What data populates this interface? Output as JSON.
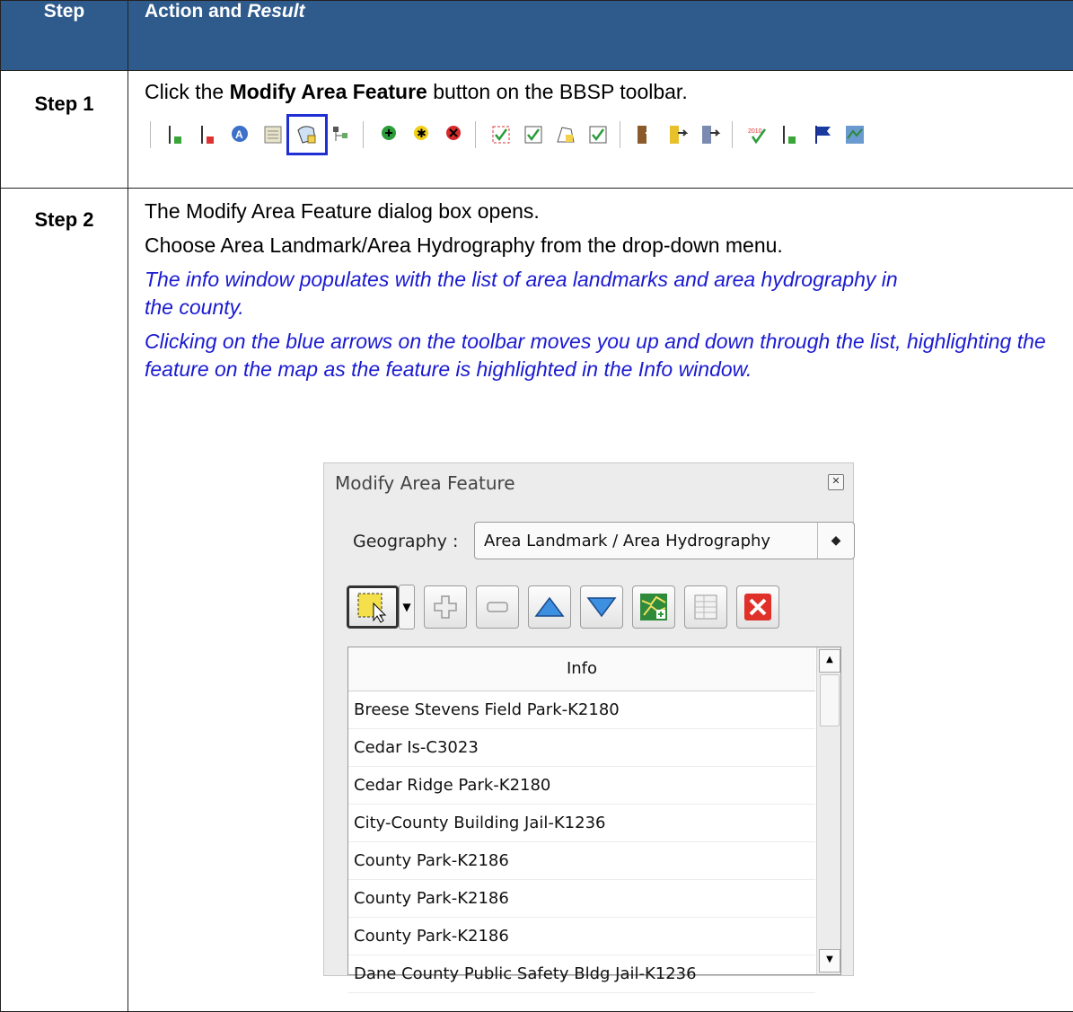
{
  "header": {
    "col1": "Step",
    "col2_prefix": "Action and ",
    "col2_italic": "Result"
  },
  "step1": {
    "label": "Step 1",
    "pre": "Click the ",
    "bold": "Modify Area Feature",
    "post": " button on the BBSP toolbar.",
    "toolbar_icons": [
      "add-line-icon",
      "delete-line-icon",
      "label-icon",
      "edit-table-icon",
      "modify-area-feature-icon",
      "tree-icon",
      "add-point-icon",
      "move-point-icon",
      "delete-point-icon",
      "check-1-icon",
      "check-2-icon",
      "check-3-icon",
      "check-4-icon",
      "export-1-icon",
      "export-2-icon",
      "export-3-icon",
      "census-2010-icon",
      "add-line-2-icon",
      "flag-icon",
      "map-icon"
    ]
  },
  "step2": {
    "label": "Step 2",
    "line1": "The Modify Area Feature dialog box opens.",
    "line2": "Choose Area Landmark/Area Hydrography from the drop-down menu.",
    "result1": "The info window populates with the list of area landmarks and area hydrography in the county.",
    "result2": "Clicking on the blue arrows on the toolbar moves you up and down through the list, highlighting the feature on the map as the feature is highlighted in the Info window."
  },
  "dialog": {
    "title": "Modify Area Feature",
    "geography_label": "Geography :",
    "geography_value": "Area Landmark / Area Hydrography",
    "list_header": "Info",
    "rows": [
      "Breese Stevens Field Park-K2180",
      "Cedar Is-C3023",
      "Cedar Ridge Park-K2180",
      "City-County Building Jail-K1236",
      "County Park-K2186",
      "County Park-K2186",
      "County Park-K2186",
      "Dane County Public Safety Bldg Jail-K1236"
    ]
  },
  "colors": {
    "header_bg": "#2f5b8c",
    "result_text": "#1a1ad0",
    "highlight": "#1f2fd4"
  }
}
